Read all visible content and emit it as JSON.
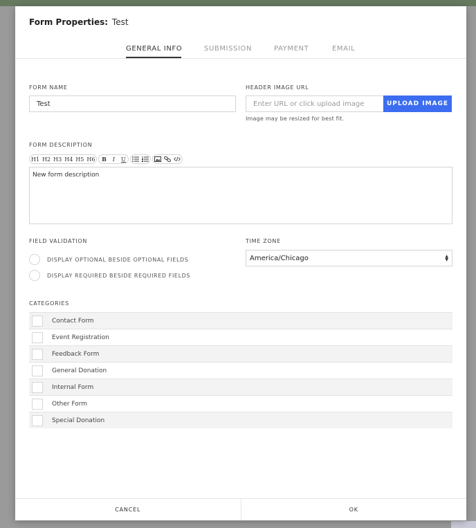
{
  "dialog": {
    "title_label": "Form Properties:",
    "form_title": "Test"
  },
  "tabs": [
    {
      "label": "GENERAL INFO",
      "active": true
    },
    {
      "label": "SUBMISSION",
      "active": false
    },
    {
      "label": "PAYMENT",
      "active": false
    },
    {
      "label": "EMAIL",
      "active": false
    }
  ],
  "form_name": {
    "label": "FORM NAME",
    "value": "Test"
  },
  "header_image": {
    "label": "HEADER IMAGE URL",
    "placeholder": "Enter URL or click upload image",
    "upload_label": "UPLOAD IMAGE",
    "hint": "Image may be resized for best fit."
  },
  "description": {
    "label": "FORM DESCRIPTION",
    "value": "New form description",
    "toolbar": {
      "headings": [
        "H1",
        "H2",
        "H3",
        "H4",
        "H5",
        "H6"
      ],
      "bold": "B",
      "italic": "I",
      "underline": "U"
    }
  },
  "field_validation": {
    "label": "FIELD VALIDATION",
    "options": [
      {
        "label": "DISPLAY OPTIONAL BESIDE OPTIONAL FIELDS",
        "checked": false
      },
      {
        "label": "DISPLAY REQUIRED BESIDE REQUIRED FIELDS",
        "checked": false
      }
    ]
  },
  "time_zone": {
    "label": "TIME ZONE",
    "value": "America/Chicago"
  },
  "categories": {
    "label": "CATEGORIES",
    "items": [
      {
        "label": "Contact Form",
        "checked": false
      },
      {
        "label": "Event Registration",
        "checked": false
      },
      {
        "label": "Feedback Form",
        "checked": false
      },
      {
        "label": "General Donation",
        "checked": false
      },
      {
        "label": "Internal Form",
        "checked": false
      },
      {
        "label": "Other Form",
        "checked": false
      },
      {
        "label": "Special Donation",
        "checked": false
      }
    ]
  },
  "footer": {
    "cancel_label": "CANCEL",
    "ok_label": "OK"
  },
  "colors": {
    "accent": "#3c6df0",
    "overlay": "#9a9a9a"
  }
}
